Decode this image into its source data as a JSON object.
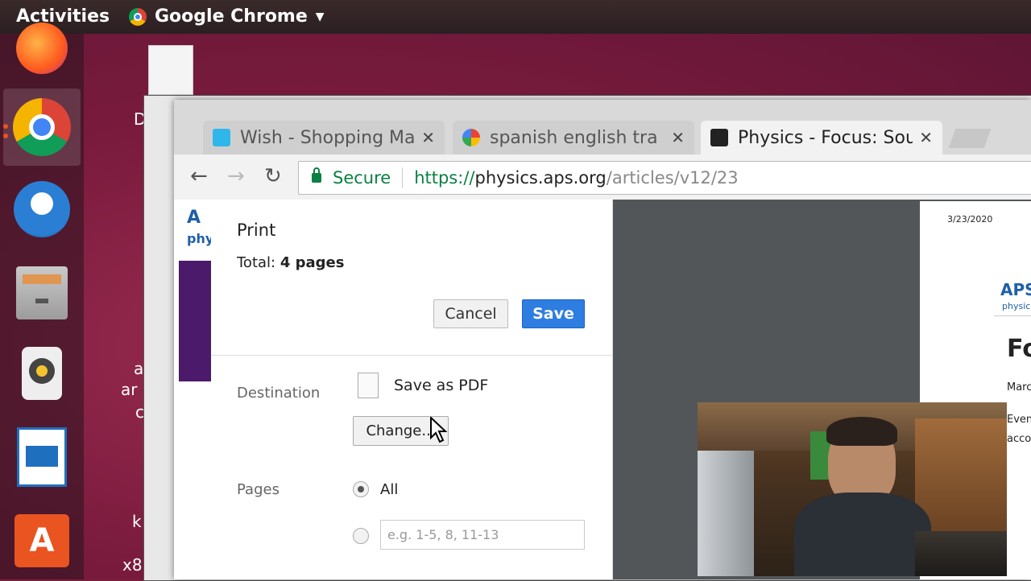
{
  "topbar": {
    "activities_label": "Activities",
    "app_name": "Google Chrome"
  },
  "desktop_fragments": {
    "frag_d": "D",
    "frag_a1": "a",
    "frag_ar": "ar",
    "frag_c": "c",
    "frag_k": "k",
    "frag_x8": "x8"
  },
  "tabs": [
    {
      "title": "Wish - Shopping Ma",
      "favicon": "wish-icon",
      "color": "#2fb7ec"
    },
    {
      "title": "spanish english tra",
      "favicon": "google-icon",
      "color": "#4285f4"
    },
    {
      "title": "Physics - Focus: Sou",
      "favicon": "physics-icon",
      "color": "#222222"
    }
  ],
  "omnibox": {
    "secure_label": "Secure",
    "url_scheme": "https://",
    "url_host": "physics.aps.org",
    "url_path": "/articles/v12/23"
  },
  "print_dialog": {
    "title": "Print",
    "total_prefix": "Total: ",
    "total_value": "4 pages",
    "cancel_label": "Cancel",
    "save_label": "Save",
    "destination_label": "Destination",
    "destination_value": "Save as PDF",
    "change_label": "Change...",
    "pages_label": "Pages",
    "pages_all_label": "All",
    "pages_placeholder": "e.g. 1-5, 8, 11-13"
  },
  "page_behind": {
    "logo_fragment": "A",
    "logo_sub": "phy"
  },
  "preview": {
    "date": "3/23/2020",
    "logo": "APS",
    "logo_sub": "physic",
    "heading": "Fo",
    "byline": "Marc",
    "text1": "Even",
    "text2": "acco"
  },
  "colors": {
    "accent_blue": "#2e7de1",
    "secure_green": "#0b8043",
    "ubuntu_orange": "#e95420"
  }
}
